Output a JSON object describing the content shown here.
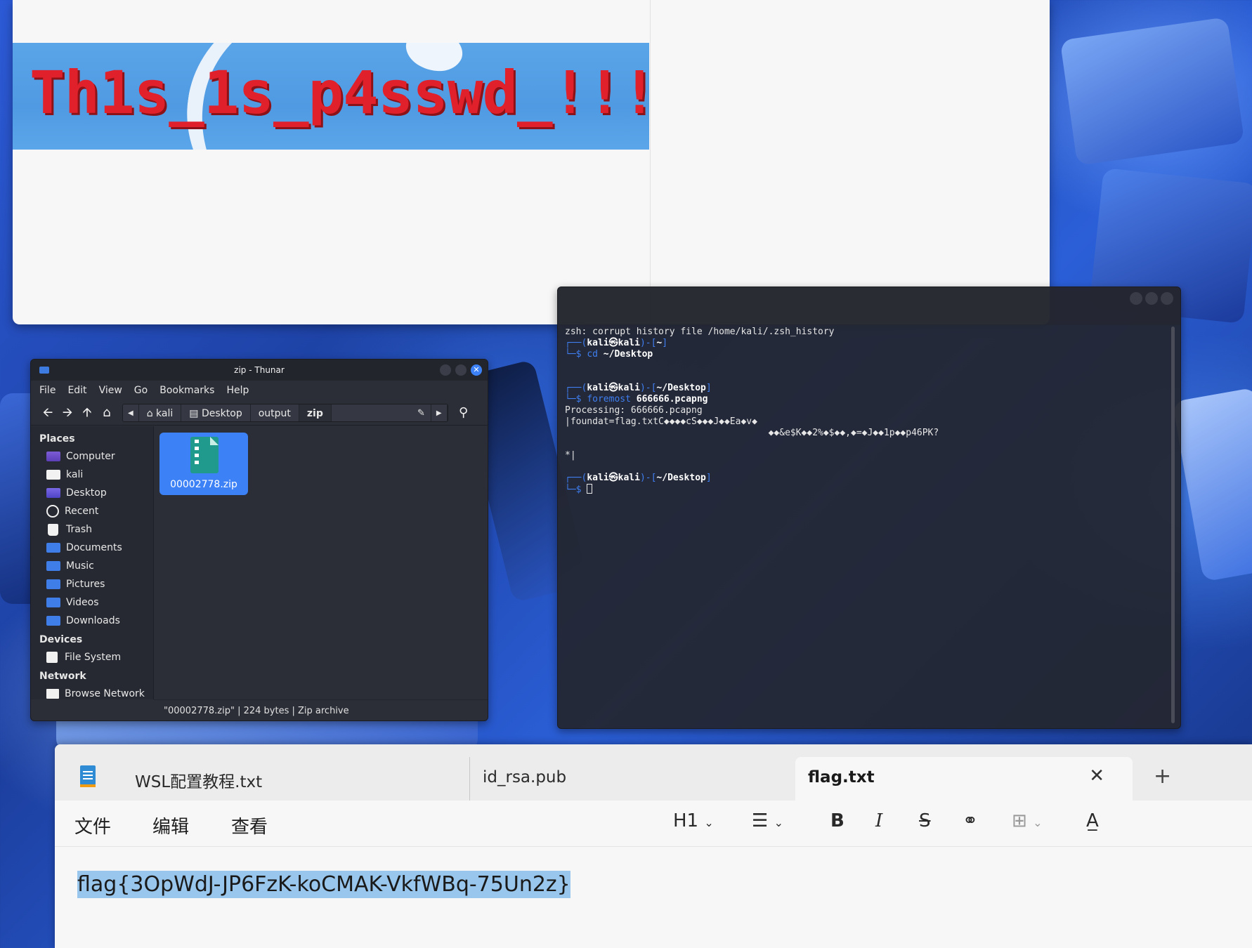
{
  "viewer": {
    "password_text": "Th1s_1s_p4sswd_!!!"
  },
  "thunar": {
    "title": "zip - Thunar",
    "close_glyph": "✕",
    "menu": [
      "File",
      "Edit",
      "View",
      "Go",
      "Bookmarks",
      "Help"
    ],
    "breadcrumbs": [
      "kali",
      "Desktop",
      "output",
      "zip"
    ],
    "sidebar": {
      "places_header": "Places",
      "places": [
        "Computer",
        "kali",
        "Desktop",
        "Recent",
        "Trash",
        "Documents",
        "Music",
        "Pictures",
        "Videos",
        "Downloads"
      ],
      "devices_header": "Devices",
      "devices": [
        "File System"
      ],
      "network_header": "Network",
      "network": [
        "Browse Network"
      ]
    },
    "file": {
      "name": "00002778.zip"
    },
    "status": "\"00002778.zip\" | 224 bytes | Zip archive"
  },
  "terminal": {
    "line1": "zsh: corrupt history file /home/kali/.zsh_history",
    "prompt_user": "kali㉿kali",
    "dir_home": "~",
    "cmd1_name": "cd",
    "cmd1_arg": "~/Desktop",
    "dir_desktop": "~/Desktop",
    "cmd2_name": "foremost",
    "cmd2_arg": "666666.pcapng",
    "out1": "Processing: 666666.pcapng",
    "out2": "|foundat=flag.txtC◆◆◆◆cS◆◆◆J◆◆Ea◆v◆",
    "out3": "                                     ◆◆&e$K◆◆2%◆$◆◆,◆=◆J◆◆1p◆◆p46PK?",
    "out4": "*|"
  },
  "notepad": {
    "tabs": [
      "WSL配置教程.txt",
      "id_rsa.pub",
      "flag.txt"
    ],
    "close_glyph": "✕",
    "newtab_glyph": "+",
    "menu": [
      "文件",
      "编辑",
      "查看"
    ],
    "heading_label": "H1",
    "content": "flag{3OpWdJ-JP6FzK-koCMAK-VkfWBq-75Un2z}"
  }
}
